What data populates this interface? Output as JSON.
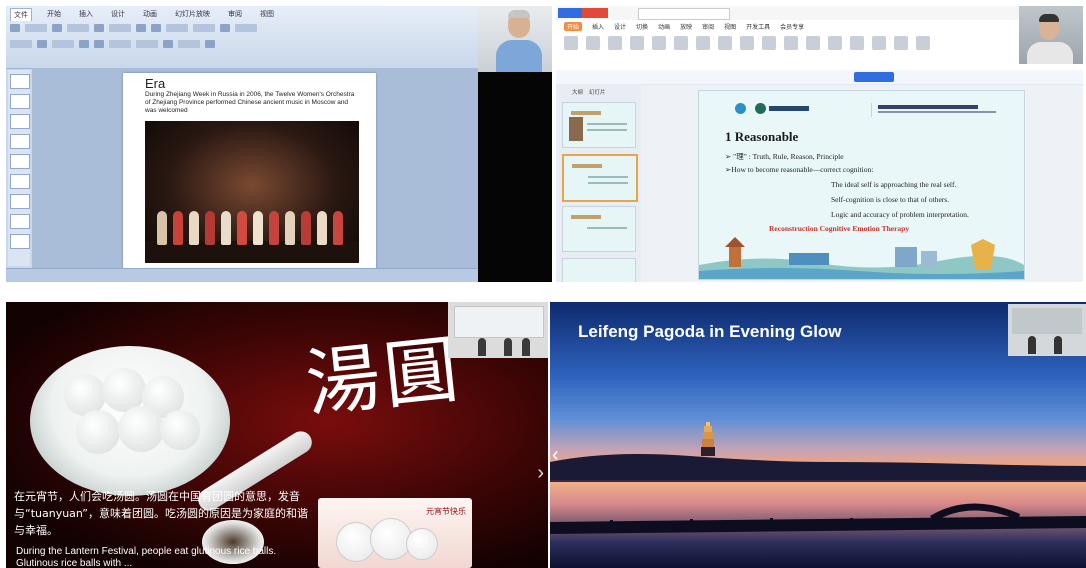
{
  "panel1": {
    "app": "PowerPoint",
    "ribbon_tabs": [
      "文件",
      "开始",
      "插入",
      "设计",
      "动画",
      "幻灯片放映",
      "审阅",
      "视图"
    ],
    "slide_title": "Era",
    "slide_text": "During Zhejiang Week in Russia in 2006, the Twelve Women's Orchestra of Zhejiang Province performed Chinese ancient music in Moscow and was welcomed"
  },
  "panel2": {
    "app": "WPS Presentation",
    "menu": [
      "开始",
      "插入",
      "设计",
      "切换",
      "动画",
      "放映",
      "审阅",
      "视图",
      "开发工具",
      "会员专享"
    ],
    "sidebar_tabs": [
      "大纲",
      "幻灯片"
    ],
    "heading": "1 Reasonable",
    "lines": [
      "➢ \"理\" : Truth, Rule, Reason, Principle",
      "➢How to become reasonable—correct cognition:",
      "The ideal self is approaching the real self.",
      "Self-cognition is close to that of others.",
      "Logic and accuracy of problem interpretation."
    ],
    "highlight": "Reconstruction Cognitive Emotion Therapy",
    "colors": {
      "accent": "#2f6de1",
      "highlight": "#c7322a"
    }
  },
  "panel3": {
    "calligraphy": "湯圓",
    "badge": "元宵节快乐",
    "cn_text": "在元宵节，人们会吃汤圆。汤圆在中国有团圆的意思，发音与“tuanyuan”，意味着团圆。吃汤圆的原因是为家庭的和谐与幸福。",
    "en_text": "During the Lantern Festival, people eat glutinous rice balls. Glutinous rice balls with ..."
  },
  "panel4": {
    "title": "Leifeng Pagoda in Evening Glow",
    "nav_prev": "‹",
    "colors": {
      "sky_top": "#0e2a6e",
      "glow": "#f2a47a"
    }
  }
}
